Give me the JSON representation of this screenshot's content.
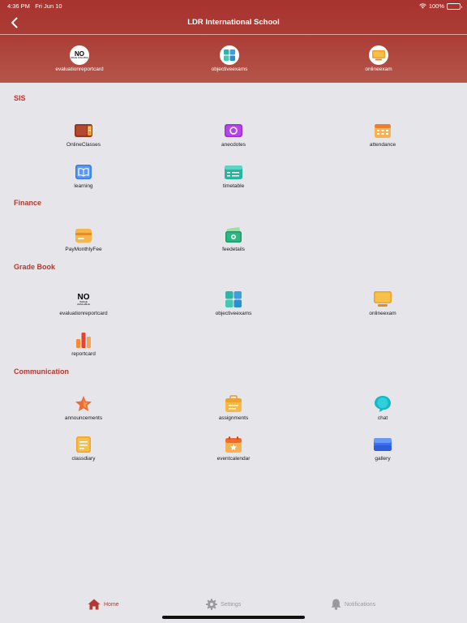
{
  "status_bar": {
    "time": "4:36 PM",
    "date": "Fri Jun 10",
    "battery": "100%"
  },
  "nav": {
    "title": "LDR International School",
    "back_icon": "chevron-left-icon"
  },
  "quick_access": [
    {
      "label": "evaluationreportcard",
      "icon": "no-logo-icon"
    },
    {
      "label": "objectiveexams",
      "icon": "tiles-icon"
    },
    {
      "label": "onlineexam",
      "icon": "monitor-icon"
    }
  ],
  "sections": {
    "sis": {
      "title": "SIS",
      "items": [
        {
          "label": "OnlineClasses",
          "icon": "book-icon"
        },
        {
          "label": "anecdotes",
          "icon": "camera-icon"
        },
        {
          "label": "attendance",
          "icon": "calendar-icon"
        },
        {
          "label": "learning",
          "icon": "open-book-icon"
        },
        {
          "label": "timetable",
          "icon": "timetable-icon"
        }
      ]
    },
    "finance": {
      "title": "Finance",
      "items": [
        {
          "label": "PayMonthlyFee",
          "icon": "card-icon"
        },
        {
          "label": "feedetails",
          "icon": "money-icon"
        }
      ]
    },
    "gradebook": {
      "title": "Grade Book",
      "items": [
        {
          "label": "evaluationreportcard",
          "icon": "no-logo-icon"
        },
        {
          "label": "objectiveexams",
          "icon": "tiles-icon"
        },
        {
          "label": "onlineexam",
          "icon": "monitor-icon"
        },
        {
          "label": "reportcard",
          "icon": "bar-chart-icon"
        }
      ]
    },
    "communication": {
      "title": "Communication",
      "items": [
        {
          "label": "announcements",
          "icon": "star-icon"
        },
        {
          "label": "assignments",
          "icon": "briefcase-icon"
        },
        {
          "label": "chat",
          "icon": "chat-bubble-icon"
        },
        {
          "label": "classdiary",
          "icon": "notepad-icon"
        },
        {
          "label": "eventcalendar",
          "icon": "event-calendar-icon"
        },
        {
          "label": "gallery",
          "icon": "gallery-icon"
        }
      ]
    }
  },
  "tabs": {
    "home": "Home",
    "settings": "Settings",
    "notifications": "Notifications"
  },
  "colors": {
    "header": "#a8332f",
    "accent": "#b23a32",
    "background": "#e6e5ea",
    "inactive_tab": "#9a9a9e"
  },
  "logo": {
    "top": "NO",
    "bottom": "IMAGE AVAILABLE"
  }
}
